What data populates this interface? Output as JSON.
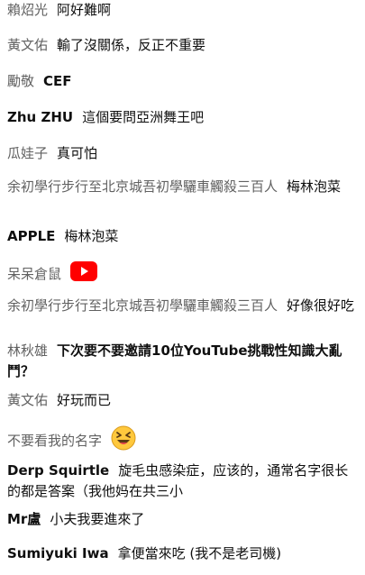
{
  "messages": [
    {
      "author": "賴炤光",
      "text": "阿好難啊"
    },
    {
      "author": "黃文佑",
      "text": "輸了沒關係，反正不重要"
    },
    {
      "author": "勵敬",
      "text": "CEF"
    },
    {
      "author": "Zhu ZHU",
      "text": "這個要問亞洲舞王吧"
    },
    {
      "author": "瓜娃子",
      "text": "真可怕"
    },
    {
      "author": "余初學行步行至北京城吾初學驪車觸殺三百人",
      "text": "梅林泡菜"
    },
    {
      "author": "APPLE",
      "text": "梅林泡菜"
    },
    {
      "author": "呆呆倉鼠",
      "emoji": "youtube-logo"
    },
    {
      "author": "余初學行步行至北京城吾初學驪車觸殺三百人",
      "text": "好像很好吃"
    },
    {
      "author": "林秋雄",
      "text": "下次要不要邀請10位YouTube挑戰性知識大亂鬥？"
    },
    {
      "author": "黃文佑",
      "text": "好玩而已"
    },
    {
      "author": "不要看我的名字",
      "emoji": "grinning-squinting-face"
    },
    {
      "author": "Derp Squirtle",
      "text": "旋毛虫感染症，应该的，通常名字很长的都是答案（我他妈在共三小"
    },
    {
      "author": "Mr盧",
      "text": "小夫我要進來了"
    },
    {
      "author": "Sumiyuki Iwa",
      "text": "拿便當來吃 (我不是老司機)"
    }
  ],
  "colors": {
    "author": "#616161",
    "text": "#0f0f0f",
    "youtube_red": "#ff0000",
    "emoji_yellow": "#ffc83d"
  }
}
